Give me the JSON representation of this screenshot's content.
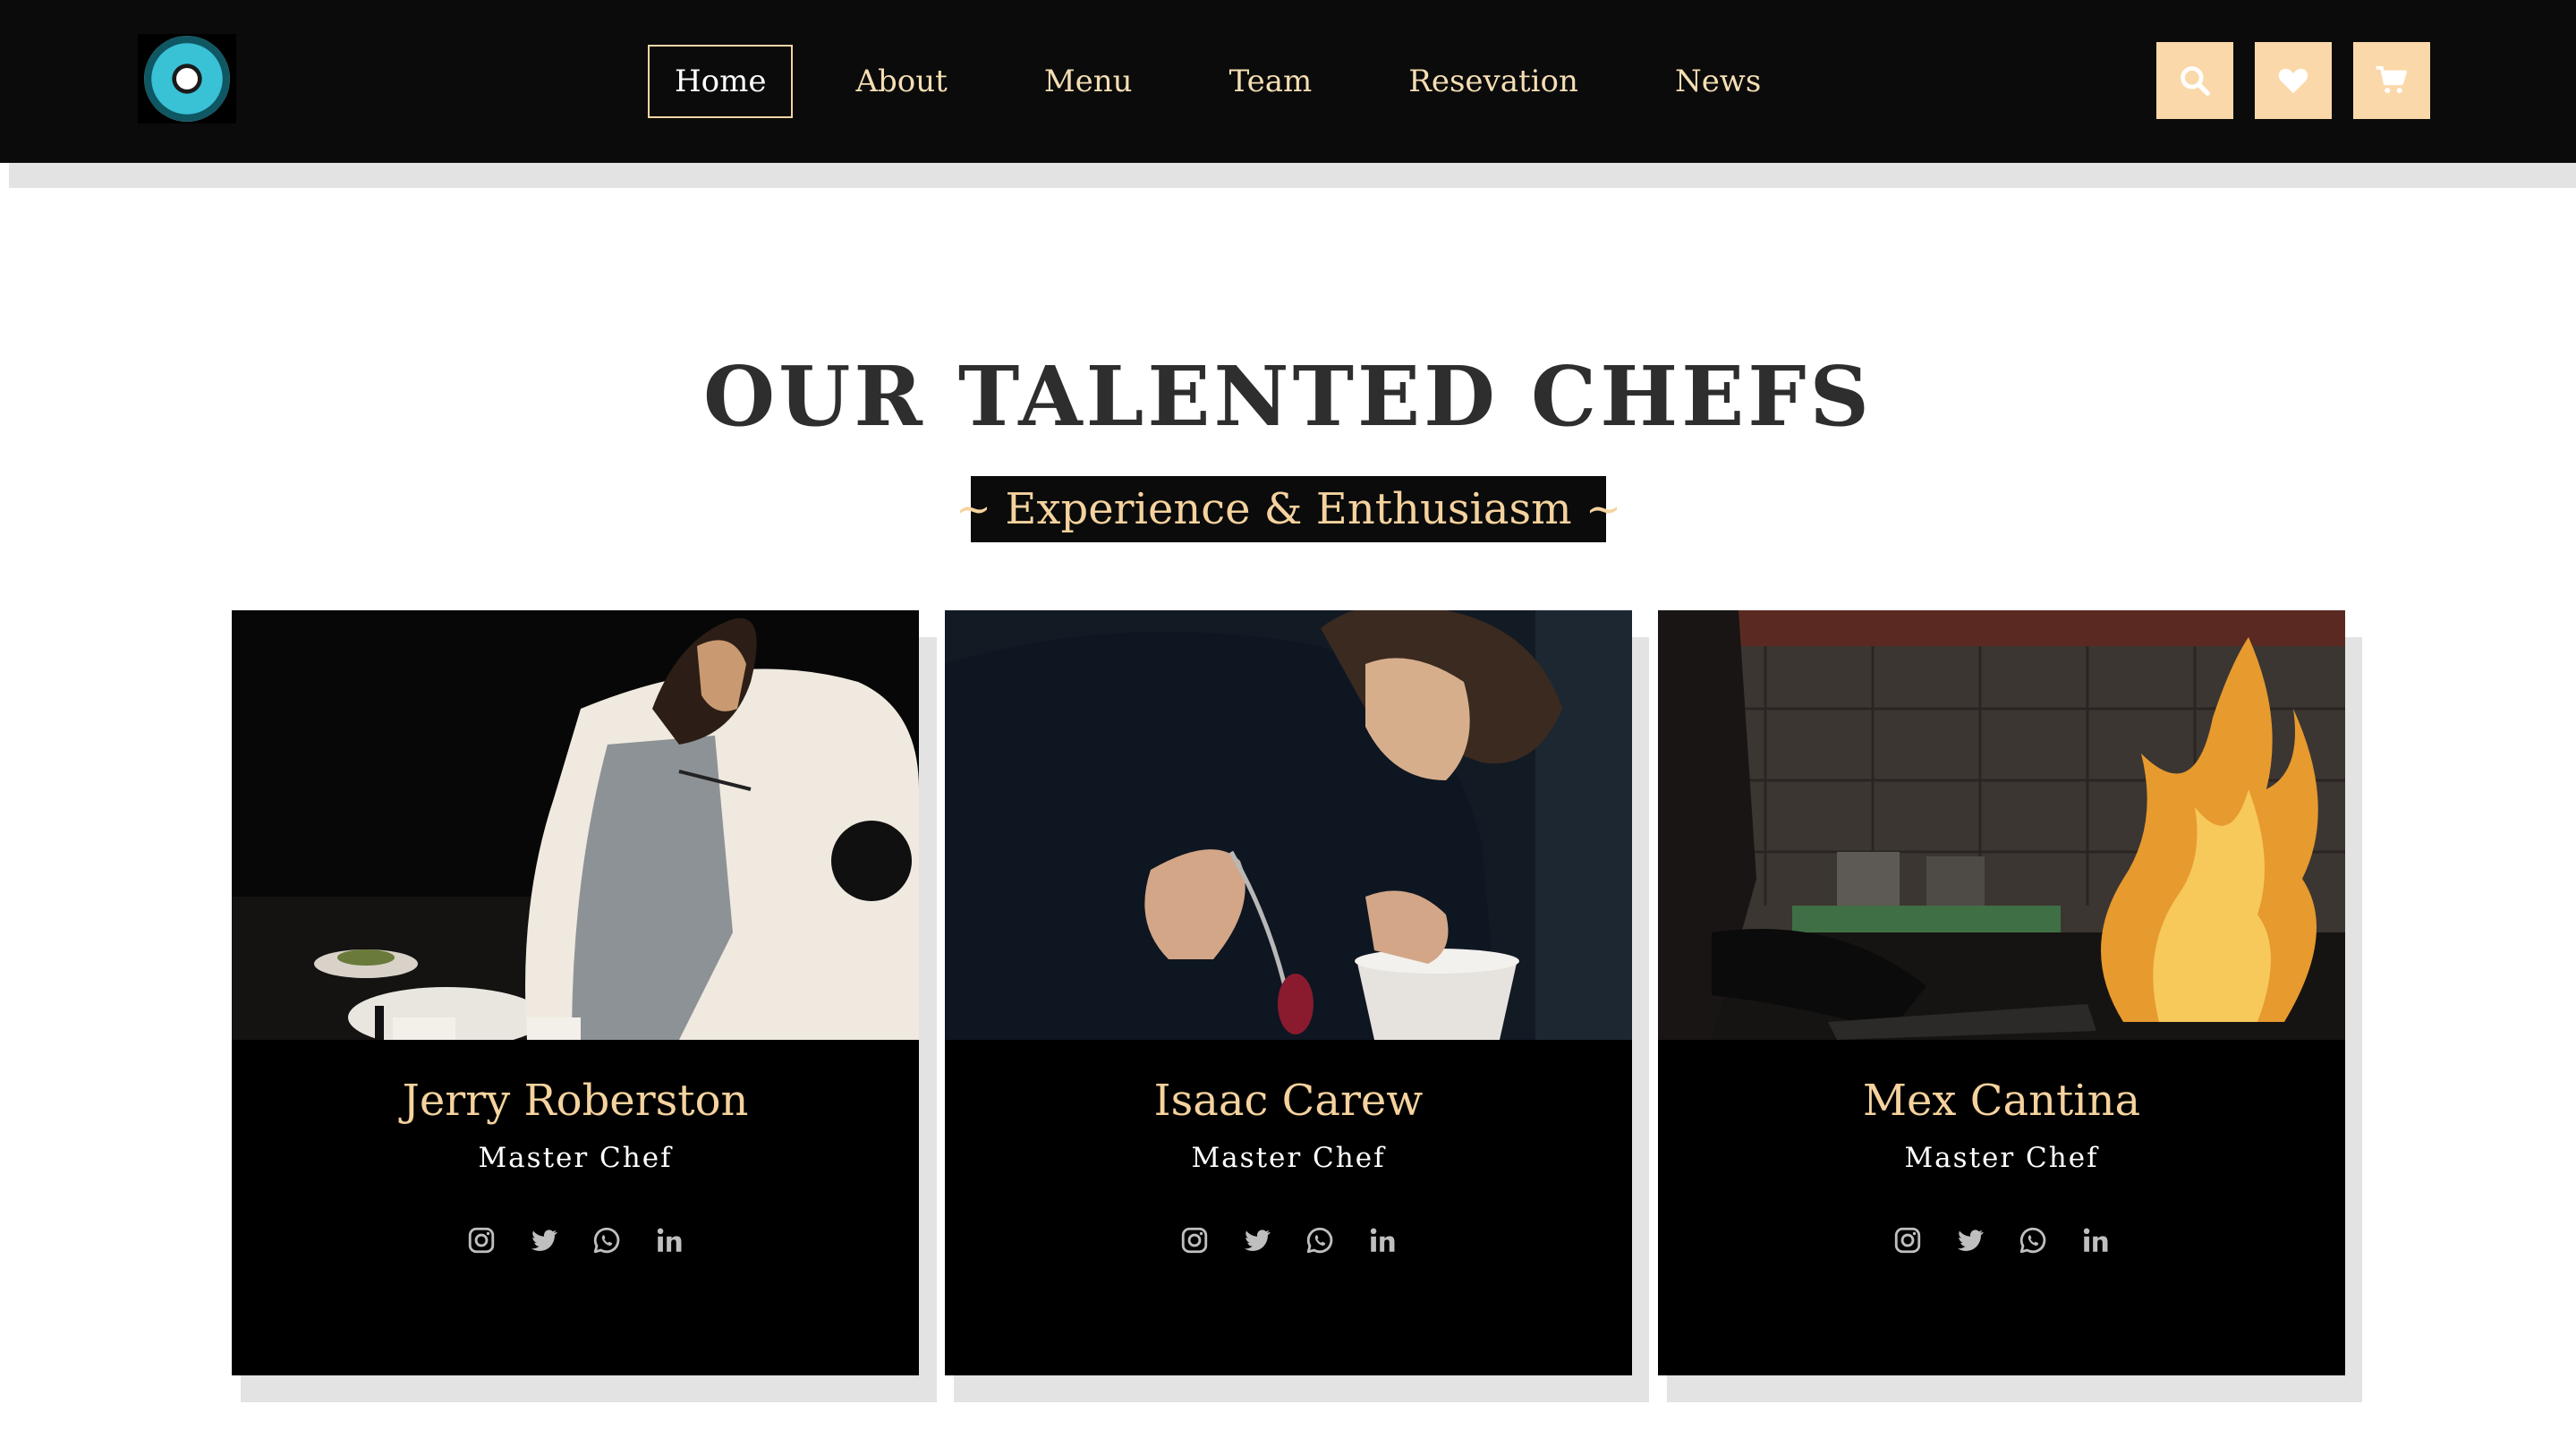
{
  "brand": {
    "logo_name": "restaurant-logo"
  },
  "nav": {
    "items": [
      {
        "label": "Home",
        "active": true
      },
      {
        "label": "About",
        "active": false
      },
      {
        "label": "Menu",
        "active": false
      },
      {
        "label": "Team",
        "active": false
      },
      {
        "label": "Resevation",
        "active": false
      },
      {
        "label": "News",
        "active": false
      }
    ]
  },
  "header_icons": [
    "search-icon",
    "heart-icon",
    "cart-icon"
  ],
  "section": {
    "title": "OUR TALENTED CHEFS",
    "subtitle": "~ Experience & Enthusiasm ~"
  },
  "chefs": [
    {
      "name": "Jerry Roberston",
      "role": "Master Chef",
      "photo": "chef plating a dish"
    },
    {
      "name": "Isaac Carew",
      "role": "Master Chef",
      "photo": "chef saucing with a spoon"
    },
    {
      "name": "Mex Cantina",
      "role": "Master Chef",
      "photo": "chef cooking with flames"
    }
  ],
  "social_icons": [
    "instagram-icon",
    "twitter-icon",
    "whatsapp-icon",
    "linkedin-icon"
  ],
  "colors": {
    "header_bg": "#0b0b0b",
    "accent": "#f5d29e",
    "icon_button_bg": "#fbd8a9",
    "title": "#2e2e2e",
    "card_bg": "#000000",
    "shadow": "#e3e3e3"
  }
}
